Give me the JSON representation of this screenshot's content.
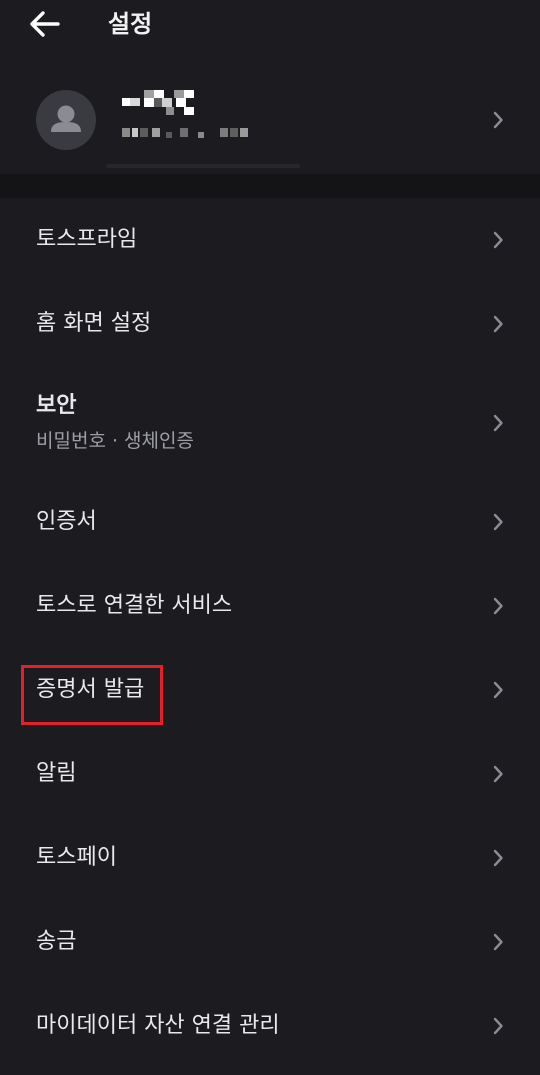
{
  "header": {
    "title": "설정",
    "back_icon": "arrow-left-icon"
  },
  "profile": {
    "avatar_icon": "person-icon",
    "chevron_icon": "chevron-right-icon"
  },
  "menu": {
    "items": [
      {
        "label": "토스프라임"
      },
      {
        "label": "홈 화면 설정"
      },
      {
        "label": "보안",
        "sub": "비밀번호 · 생체인증"
      },
      {
        "label": "인증서"
      },
      {
        "label": "토스로 연결한 서비스"
      },
      {
        "label": "증명서 발급"
      },
      {
        "label": "알림"
      },
      {
        "label": "토스페이"
      },
      {
        "label": "송금"
      },
      {
        "label": "마이데이터 자산 연결 관리"
      }
    ]
  },
  "colors": {
    "background": "#1c1c20",
    "text": "#e9e9ec",
    "subtext": "#9d9ea6",
    "chevron": "#8a8b93",
    "highlight": "#e3202a"
  }
}
